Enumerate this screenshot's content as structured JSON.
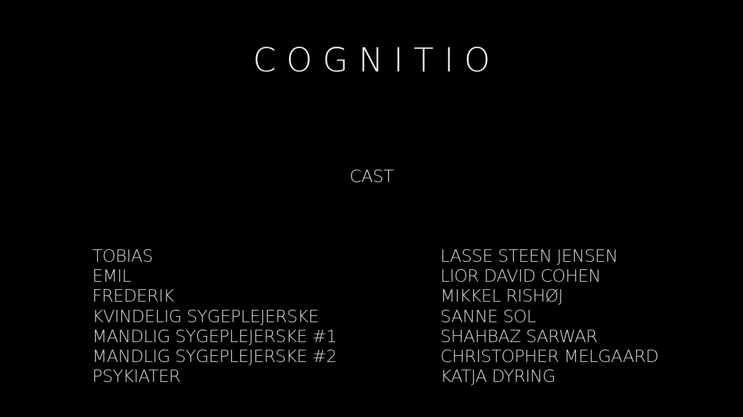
{
  "title": "COGNITIO",
  "section_heading": "CAST",
  "cast": [
    {
      "role": "TOBIAS",
      "actor": "LASSE STEEN JENSEN"
    },
    {
      "role": "EMIL",
      "actor": "LIOR DAVID COHEN"
    },
    {
      "role": "FREDERIK",
      "actor": "MIKKEL RISHØJ"
    },
    {
      "role": "KVINDELIG SYGEPLEJERSKE",
      "actor": "SANNE SOL"
    },
    {
      "role": "MANDLIG SYGEPLEJERSKE #1",
      "actor": "SHAHBAZ SARWAR"
    },
    {
      "role": "MANDLIG SYGEPLEJERSKE #2",
      "actor": "CHRISTOPHER MELGAARD"
    },
    {
      "role": "PSYKIATER",
      "actor": "KATJA DYRING"
    }
  ],
  "colors": {
    "background": "#000000",
    "text": "#ffffff"
  }
}
